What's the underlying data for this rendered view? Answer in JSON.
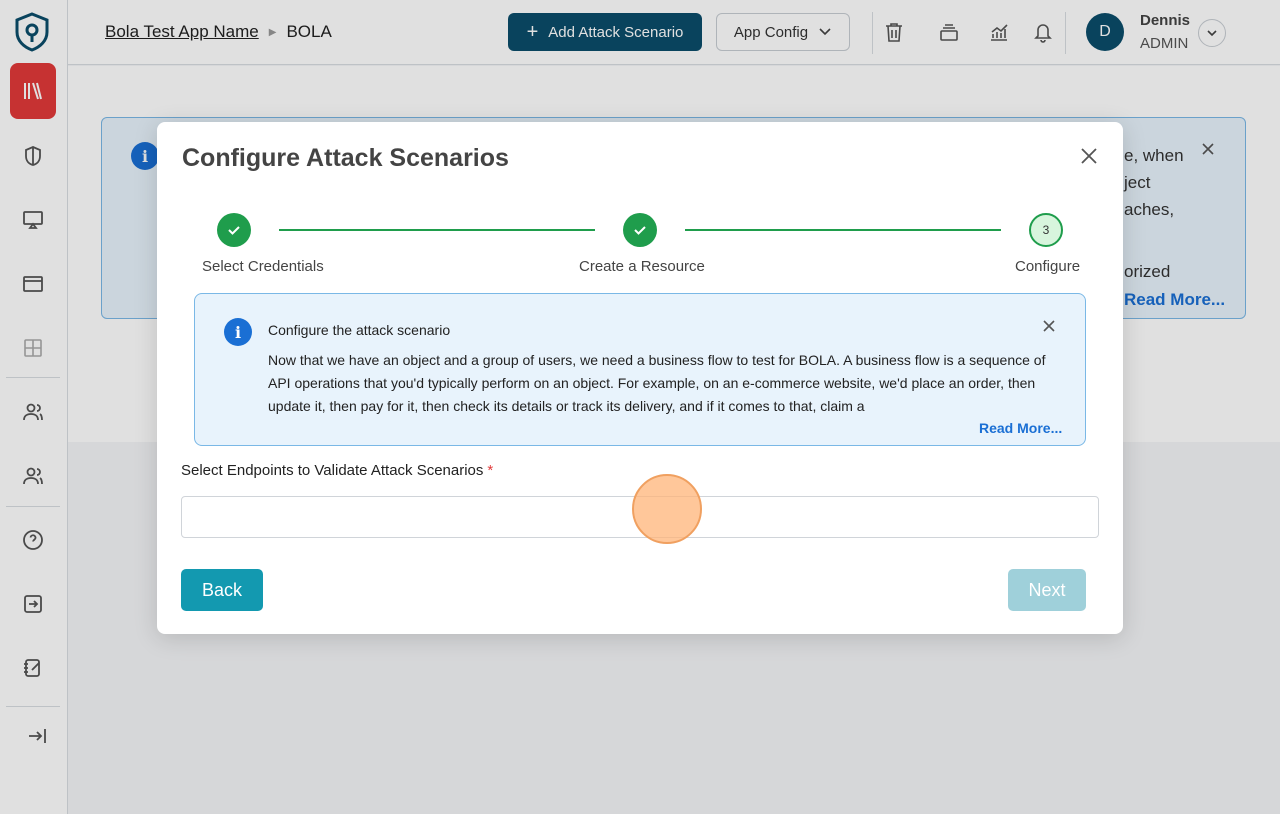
{
  "header": {
    "breadcrumb_app": "Bola Test App Name",
    "breadcrumb_page": "BOLA",
    "add_scenario_label": "Add Attack Scenario",
    "app_config_label": "App Config",
    "user_initial": "D",
    "user_name": "Dennis",
    "user_role": "ADMIN"
  },
  "background": {
    "banner_lines": [
      "e, when",
      "ject",
      "aches,",
      "orized"
    ],
    "read_more": "Read More..."
  },
  "modal": {
    "title": "Configure Attack Scenarios",
    "steps": [
      {
        "label": "Select Credentials",
        "state": "done"
      },
      {
        "label": "Create a Resource",
        "state": "done"
      },
      {
        "label": "Configure",
        "number": "3",
        "state": "current"
      }
    ],
    "info": {
      "title": "Configure the attack scenario",
      "body": "Now that we have an object and a group of users, we need a business flow to test for BOLA. A business flow is a sequence of API operations that you'd typically perform on an object. For example, on an e-commerce website, we'd place an order, then update it, then pay for it, then check its details or track its delivery, and if it comes to that, claim a",
      "read_more": "Read More..."
    },
    "field_label": "Select Endpoints to Validate Attack Scenarios",
    "field_required_mark": "*",
    "field_value": "",
    "back_label": "Back",
    "next_label": "Next"
  },
  "colors": {
    "primary": "#0b4d6a",
    "teal": "#1399b0",
    "success": "#1f9d4c",
    "danger": "#e23a3a",
    "link": "#1a6fd4"
  }
}
